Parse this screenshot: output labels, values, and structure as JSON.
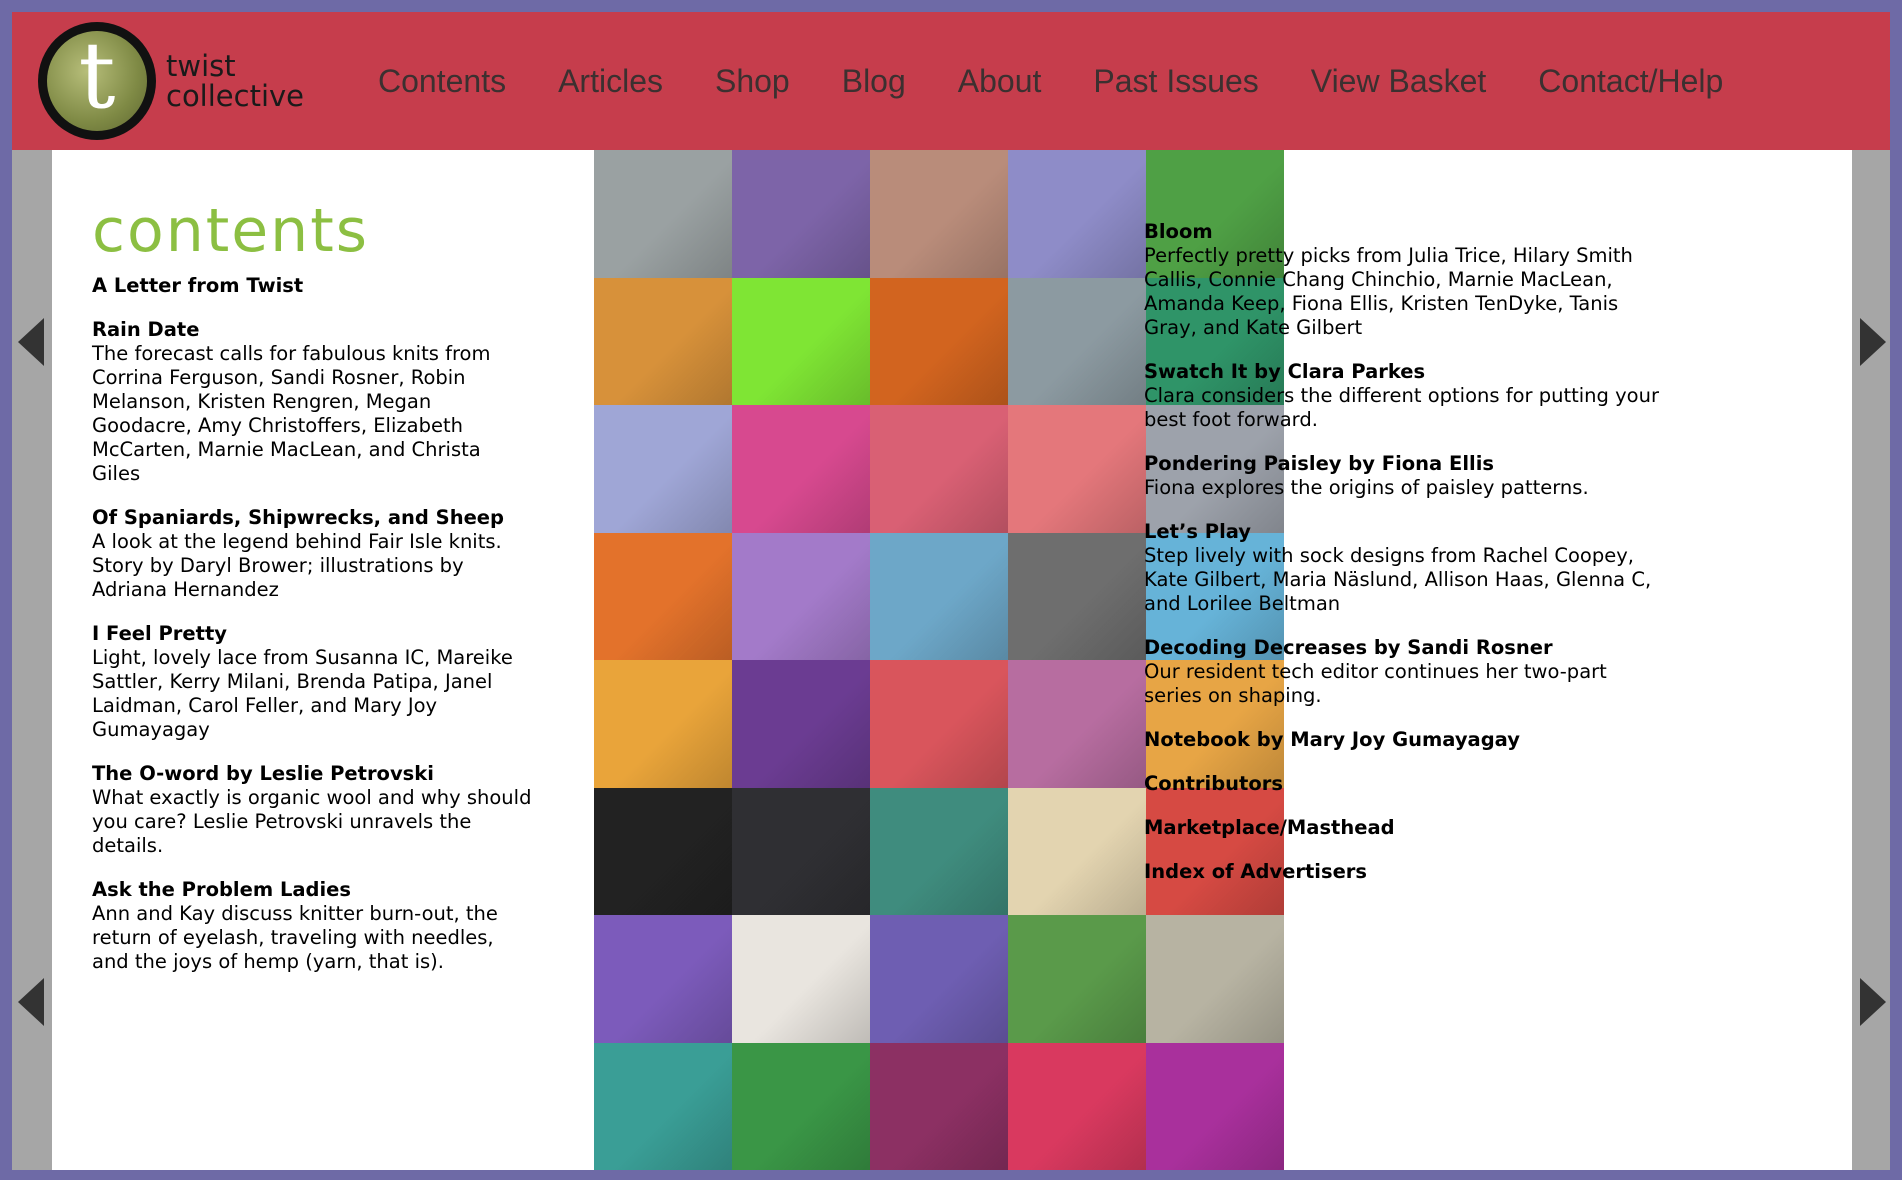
{
  "brand": {
    "letter": "t",
    "line1": "twist",
    "line2": "collective"
  },
  "nav": [
    "Contents",
    "Articles",
    "Shop",
    "Blog",
    "About",
    "Past Issues",
    "View Basket",
    "Contact/Help"
  ],
  "heading": "contents",
  "left_entries": [
    {
      "title": "A Letter from Twist",
      "desc": ""
    },
    {
      "title": "Rain Date",
      "desc": "The forecast calls for fabulous knits from Corrina Ferguson, Sandi Rosner, Robin Melanson, Kristen Rengren, Megan Goodacre, Amy Christoffers, Elizabeth McCarten, Marnie MacLean, and Christa Giles"
    },
    {
      "title": "Of Spaniards, Shipwrecks, and Sheep",
      "desc": "A look at the legend behind Fair Isle knits. Story by Daryl Brower; illustrations by Adriana Hernandez"
    },
    {
      "title": "I Feel Pretty",
      "desc": "Light, lovely lace from Susanna IC, Mareike Sattler, Kerry Milani, Brenda Patipa, Janel Laidman, Carol Feller, and Mary Joy Gumayagay"
    },
    {
      "title": "The O-word by Leslie Petrovski",
      "desc": "What exactly is organic wool and why should you care? Leslie Petrovski unravels the details."
    },
    {
      "title": "Ask the Problem Ladies",
      "desc": "Ann and Kay discuss knitter burn-out, the return of eyelash, traveling with needles, and the joys of hemp (yarn, that is)."
    }
  ],
  "right_entries": [
    {
      "title": "Bloom",
      "desc": "Perfectly pretty picks from Julia Trice, Hilary Smith Callis, Connie Chang Chinchio, Marnie MacLean, Amanda Keep, Fiona Ellis, Kristen TenDyke, Tanis Gray, and Kate Gilbert"
    },
    {
      "title": "Swatch It by Clara Parkes",
      "desc": "Clara considers the different options for putting your best foot forward."
    },
    {
      "title": "Pondering Paisley by Fiona Ellis",
      "desc": "Fiona explores the origins of paisley patterns."
    },
    {
      "title": "Let’s Play",
      "desc": "Step lively with sock designs from Rachel Coopey, Kate Gilbert, Maria Näslund, Allison Haas, Glenna C, and Lorilee Beltman"
    },
    {
      "title": "Decoding Decreases by Sandi Rosner",
      "desc": "Our resident tech editor continues her two-part series on shaping."
    },
    {
      "title": "Notebook by Mary Joy Gumayagay",
      "desc": ""
    },
    {
      "title": "Contributors",
      "desc": ""
    },
    {
      "title": "Marketplace/Masthead",
      "desc": ""
    },
    {
      "title": "Index of Advertisers",
      "desc": ""
    }
  ],
  "tiles": [
    "#9aa1a2",
    "#7d64a8",
    "#b98c7a",
    "#8e8cc8",
    "#4fa045",
    "#d7913a",
    "#7fe534",
    "#d2641f",
    "#8c9aa1",
    "#2f9468",
    "#9fa6d6",
    "#d7498f",
    "#d96074",
    "#e4777b",
    "#9da2ab",
    "#e3722b",
    "#a37ac9",
    "#6da7c8",
    "#6e6e6e",
    "#66b3d8",
    "#e9a43a",
    "#6b3c92",
    "#d9555c",
    "#b76da0",
    "#e7a545",
    "#222222",
    "#2f2f33",
    "#3f8c7e",
    "#e3d4b0",
    "#d64a43",
    "#7c5bbb",
    "#e9e5df",
    "#6e5eb2",
    "#5a9a4a",
    "#b7b3a2",
    "#3a9e96",
    "#3a9646",
    "#8c3063",
    "#d9395f",
    "#a9309c"
  ]
}
